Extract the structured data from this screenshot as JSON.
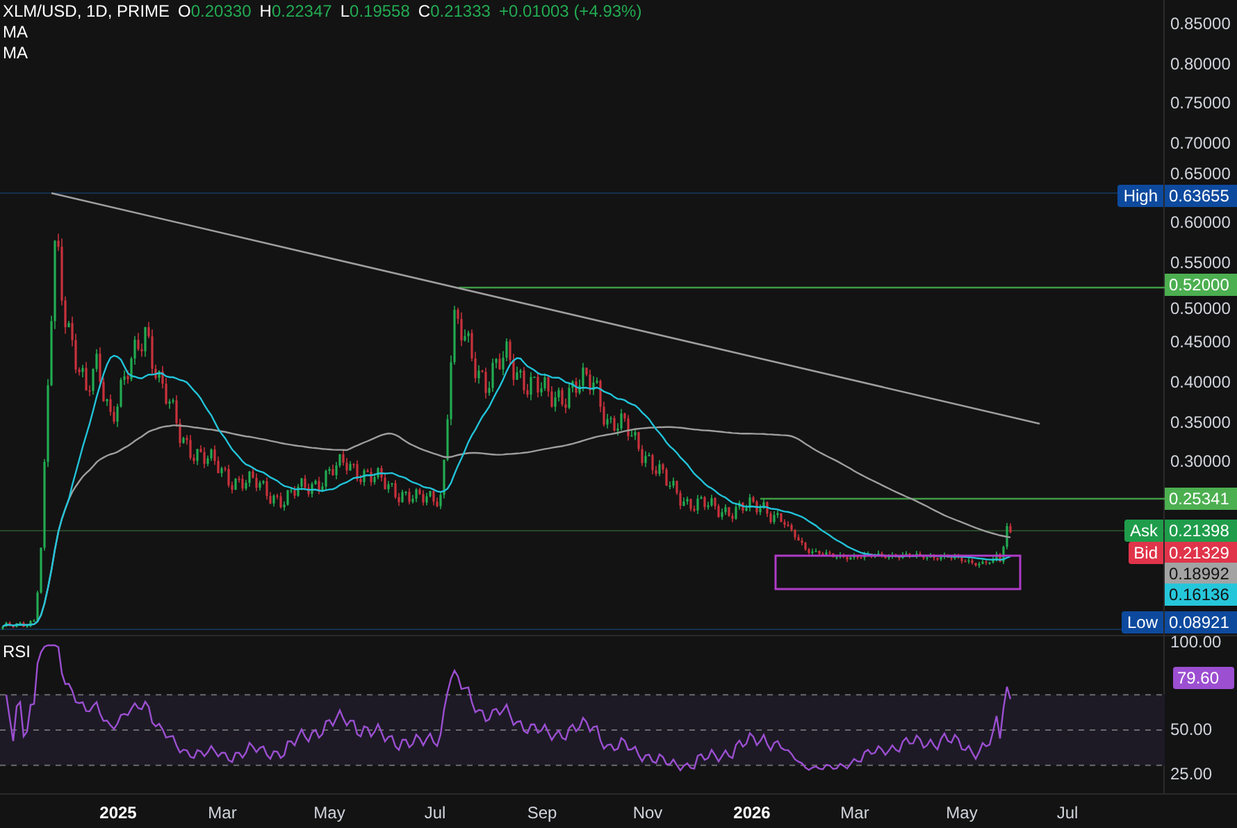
{
  "header": {
    "title": "XLM/USD, 1D, PRIME",
    "ohlc": [
      {
        "label": "O",
        "value": "0.20330"
      },
      {
        "label": "H",
        "value": "0.22347"
      },
      {
        "label": "L",
        "value": "0.19558"
      },
      {
        "label": "C",
        "value": "0.21333"
      }
    ],
    "change": "+0.01003 (+4.93%)"
  },
  "indicators": [
    {
      "label": "MA"
    },
    {
      "label": "MA"
    }
  ],
  "price_axis": {
    "ticks": [
      "0.85000",
      "0.80000",
      "0.75000",
      "0.70000",
      "0.65000",
      "0.60000",
      "0.55000",
      "0.50000",
      "0.45000",
      "0.40000",
      "0.35000",
      "0.30000"
    ]
  },
  "price_tags": [
    {
      "label": "High",
      "value": "0.63655",
      "color": "#0d4a9e"
    },
    {
      "value": "0.52000",
      "color": "#4caf50"
    },
    {
      "value": "0.25341",
      "color": "#4caf50"
    },
    {
      "label": "Ask",
      "value": "0.21398",
      "color": "#1f9d4b"
    },
    {
      "label": "Bid",
      "value": "0.21329",
      "color": "#e0344a"
    },
    {
      "value": "0.18992",
      "color": "#a3a3a3"
    },
    {
      "value": "0.16136",
      "color": "#26c6da"
    },
    {
      "label": "Low",
      "value": "0.08921",
      "color": "#0d4a9e"
    }
  ],
  "rsi": {
    "label": "RSI",
    "ticks": [
      "100.00",
      "50.00",
      "25.00"
    ],
    "value_tag": {
      "value": "79.60",
      "color": "#9c4fd1"
    }
  },
  "time_axis": [
    {
      "label": "2025",
      "kind": "year"
    },
    {
      "label": "Mar",
      "kind": "month"
    },
    {
      "label": "May",
      "kind": "month"
    },
    {
      "label": "Jul",
      "kind": "month"
    },
    {
      "label": "Sep",
      "kind": "month"
    },
    {
      "label": "Nov",
      "kind": "month"
    },
    {
      "label": "2026",
      "kind": "year"
    },
    {
      "label": "Mar",
      "kind": "month"
    },
    {
      "label": "May",
      "kind": "month"
    },
    {
      "label": "Jul",
      "kind": "month"
    }
  ]
}
